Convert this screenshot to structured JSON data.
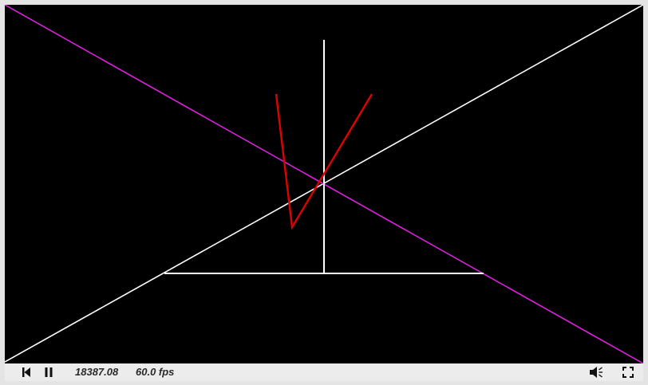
{
  "player": {
    "time_display": "18387.08",
    "fps_display": "60.0 fps"
  },
  "controls": {
    "rewind_icon": "skip-to-start-icon",
    "pause_icon": "pause-icon",
    "volume_icon": "speaker-volume-icon",
    "fullscreen_icon": "fullscreen-icon"
  },
  "scene": {
    "background": "#000000",
    "colors": {
      "white_lines": "#ffffff",
      "magenta_line": "#e020e0",
      "red_lines": "#e00000"
    }
  }
}
